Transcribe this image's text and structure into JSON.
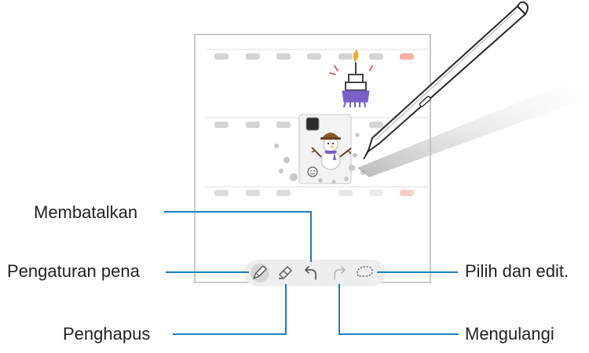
{
  "callouts": {
    "undo": "Membatalkan",
    "pen_settings": "Pengaturan pena",
    "eraser": "Penghapus",
    "select_edit": "Pilih dan edit.",
    "redo": "Mengulangi"
  },
  "toolbar": {
    "icons": [
      "pen-settings-icon",
      "eraser-icon",
      "undo-icon",
      "redo-icon",
      "lasso-select-icon"
    ]
  },
  "colors": {
    "leader_line": "#1a7fc4",
    "screen_border": "#b8b8b8",
    "toolbar_bg": "#eeeeee",
    "blurred_text": "#d0d0d0",
    "accent_red": "#f0a090",
    "drawing_purple": "#7a5fc8",
    "drawing_orange": "#f5a623",
    "pen_body": "#ffffff",
    "pen_shadow": "#c8c8c8"
  }
}
